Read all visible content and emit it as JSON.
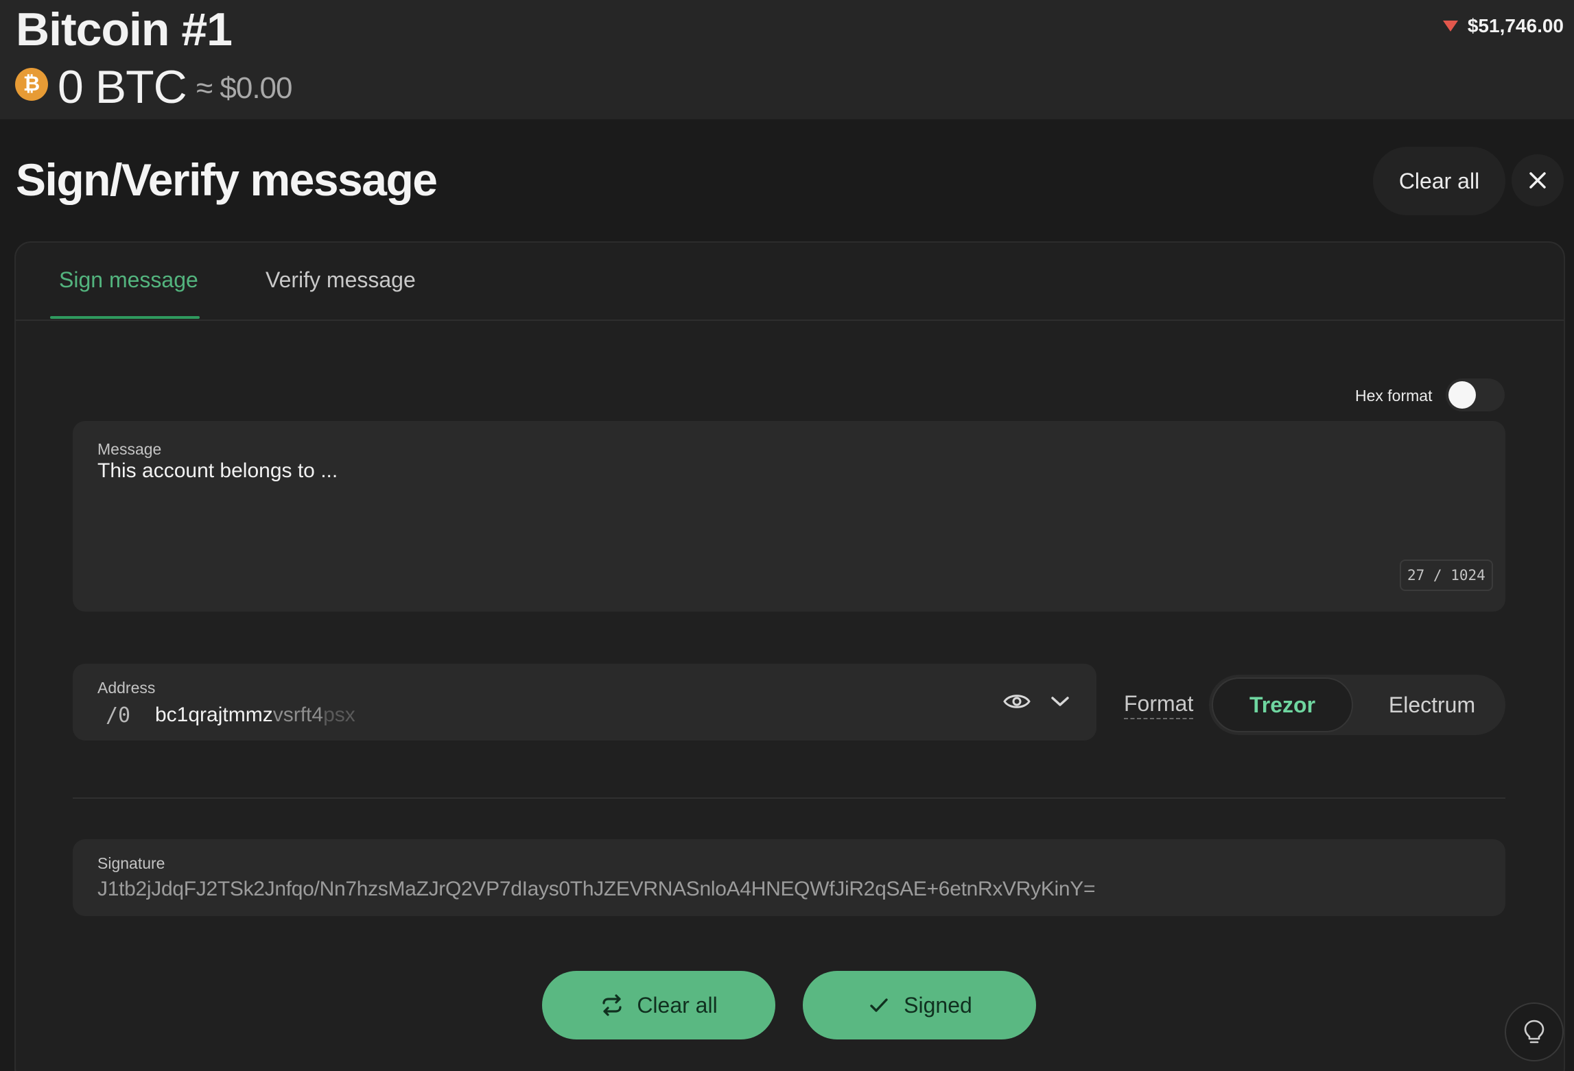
{
  "header": {
    "account_name": "Bitcoin #1",
    "coin_symbol_glyph": "₿",
    "balance": "0 BTC",
    "fiat_balance": "≈ $0.00",
    "price": "$51,746.00",
    "price_trend": "down"
  },
  "page": {
    "title": "Sign/Verify message",
    "clear_all_label": "Clear all"
  },
  "tabs": [
    {
      "label": "Sign message",
      "active": true
    },
    {
      "label": "Verify message",
      "active": false
    }
  ],
  "hex_format": {
    "label": "Hex format",
    "enabled": false
  },
  "message": {
    "label": "Message",
    "value": "This account belongs to ...",
    "counter": "27 / 1024"
  },
  "address": {
    "label": "Address",
    "path": "/0",
    "value_visible": "bc1qrajtmmz",
    "value_faded": "vsrft4",
    "value_more_faded": "psx"
  },
  "format": {
    "label": "Format",
    "options": [
      "Trezor",
      "Electrum"
    ],
    "selected": "Trezor"
  },
  "signature": {
    "label": "Signature",
    "value": "J1tb2jJdqFJ2TSk2Jnfqo/Nn7hzsMaZJrQ2VP7dIays0ThJZEVRNASnloA4HNEQWfJiR2qSAE+6etnRxVRyKinY="
  },
  "actions": {
    "clear_all_label": "Clear all",
    "signed_label": "Signed"
  },
  "colors": {
    "accent": "#53b47e",
    "button_bg": "#5ab882",
    "price_down": "#e2574c",
    "bitcoin": "#e79b35"
  }
}
